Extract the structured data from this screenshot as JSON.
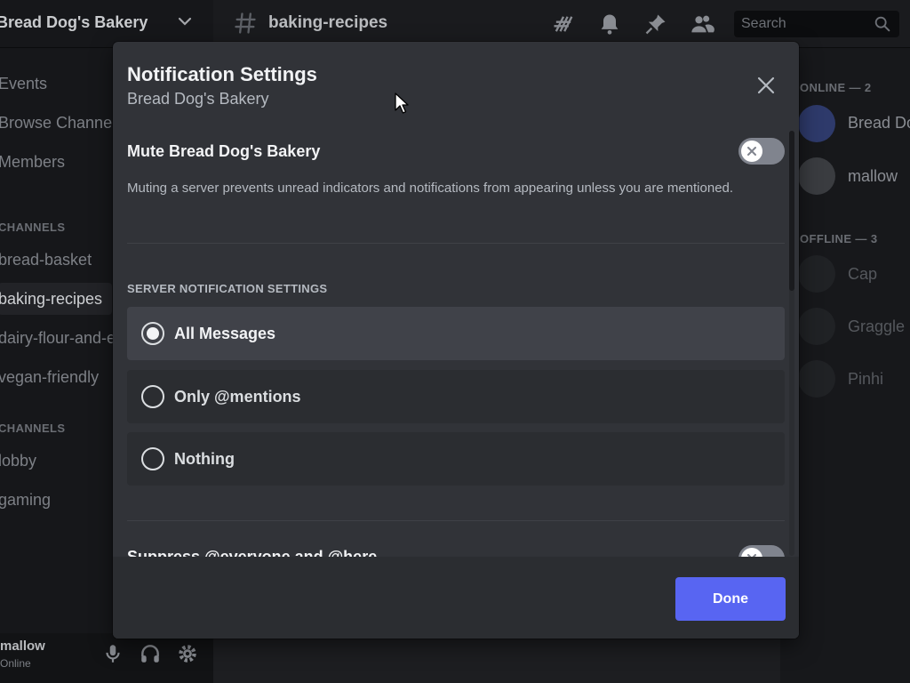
{
  "server": {
    "name": "Bread Dog's Bakery"
  },
  "sidebar": {
    "items": [
      {
        "label": "Events"
      },
      {
        "label": "Browse Channels"
      },
      {
        "label": "Members"
      }
    ],
    "categories": [
      {
        "label": "CHANNELS",
        "channels": [
          {
            "label": "bread-basket",
            "active": false
          },
          {
            "label": "baking-recipes",
            "active": true
          },
          {
            "label": "dairy-flour-and-eggs",
            "active": false
          },
          {
            "label": "vegan-friendly",
            "active": false
          }
        ]
      },
      {
        "label": "CHANNELS",
        "channels": [
          {
            "label": "lobby",
            "active": false
          },
          {
            "label": "gaming",
            "active": false
          }
        ]
      }
    ]
  },
  "user": {
    "name": "mallow",
    "status": "Online"
  },
  "topbar": {
    "channel": "baking-recipes",
    "search_placeholder": "Search"
  },
  "members": {
    "online_header": "ONLINE — 2",
    "offline_header": "OFFLINE — 3",
    "online": [
      {
        "name": "Bread Dog"
      },
      {
        "name": "mallow"
      }
    ],
    "offline": [
      {
        "name": "Cap"
      },
      {
        "name": "Graggle"
      },
      {
        "name": "Pinhi"
      }
    ]
  },
  "modal": {
    "title": "Notification Settings",
    "subtitle": "Bread Dog's Bakery",
    "mute": {
      "label": "Mute Bread Dog's Bakery",
      "description": "Muting a server prevents unread indicators and notifications from appearing unless you are mentioned.",
      "enabled": false
    },
    "server_settings": {
      "header": "SERVER NOTIFICATION SETTINGS",
      "options": [
        {
          "label": "All Messages",
          "selected": true
        },
        {
          "label": "Only @mentions",
          "selected": false
        },
        {
          "label": "Nothing",
          "selected": false
        }
      ]
    },
    "suppress": {
      "label": "Suppress @everyone and @here",
      "enabled": false
    },
    "done_label": "Done"
  },
  "colors": {
    "accent": "#5865f2",
    "modal_bg": "#313338",
    "footer_bg": "#2b2d31",
    "selected_option_bg": "#404249"
  }
}
